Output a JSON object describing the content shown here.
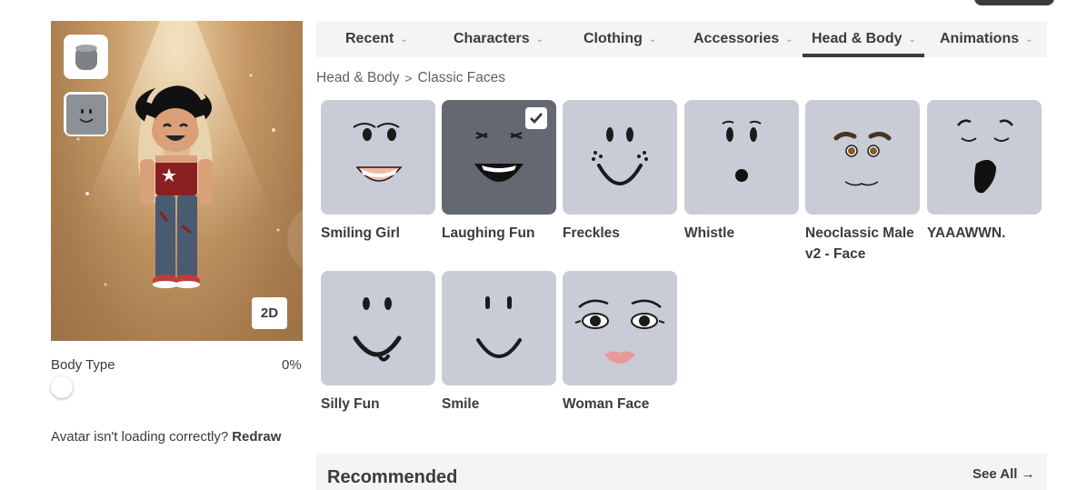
{
  "avatar": {
    "view_toggle_label": "2D",
    "thumbnails": [
      "head-shape-icon",
      "classic-face-icon"
    ],
    "body_type_label": "Body Type",
    "body_type_value": "0%",
    "loading_text": "Avatar isn't loading correctly?",
    "redraw_label": "Redraw"
  },
  "tabs": [
    {
      "label": "Recent",
      "active": false
    },
    {
      "label": "Characters",
      "active": false
    },
    {
      "label": "Clothing",
      "active": false
    },
    {
      "label": "Accessories",
      "active": false
    },
    {
      "label": "Head & Body",
      "active": true
    },
    {
      "label": "Animations",
      "active": false
    }
  ],
  "breadcrumb": {
    "parent": "Head & Body",
    "separator": ">",
    "current": "Classic Faces"
  },
  "items": [
    {
      "name": "Smiling Girl",
      "selected": false
    },
    {
      "name": "Laughing Fun",
      "selected": true
    },
    {
      "name": "Freckles",
      "selected": false
    },
    {
      "name": "Whistle",
      "selected": false
    },
    {
      "name": "Neoclassic Male v2 - Face",
      "selected": false
    },
    {
      "name": "YAAAWWN.",
      "selected": false
    },
    {
      "name": "Silly Fun",
      "selected": false
    },
    {
      "name": "Smile",
      "selected": false
    },
    {
      "name": "Woman Face",
      "selected": false
    }
  ],
  "recommended": {
    "title": "Recommended",
    "see_all_label": "See All →"
  },
  "colors": {
    "tile_bg": "#c9ccd6",
    "tile_selected_bg": "#646870",
    "tab_bar_bg": "#f2f4f5",
    "text": "#393b3d"
  }
}
